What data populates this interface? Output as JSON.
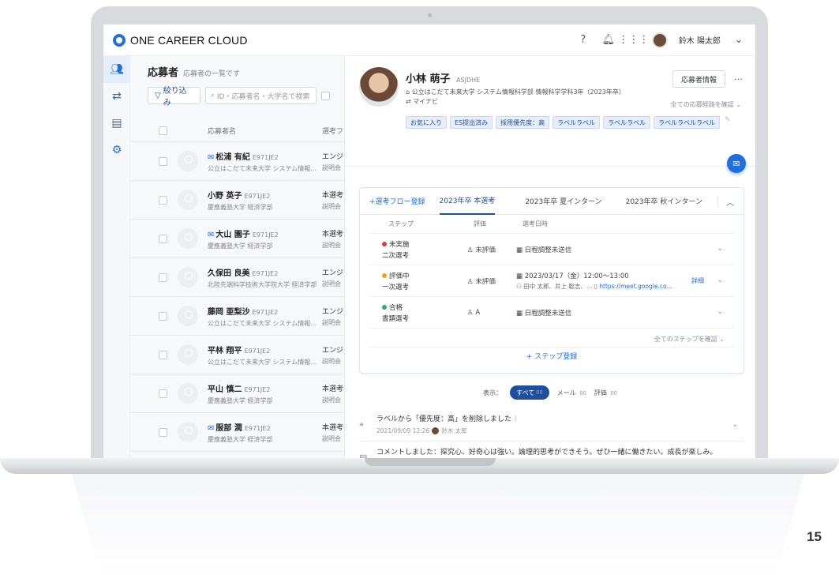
{
  "app": {
    "brand": "ONE CAREER CLOUD",
    "user_name": "鈴木 陽太郎"
  },
  "page_number": "15",
  "list": {
    "title": "応募者",
    "subtitle": "応募者の一覧です",
    "filter_label": "絞り込み",
    "search_placeholder": "ID・応募者名・大学名で検索",
    "col_name": "応募者名",
    "col_flow": "選考フ",
    "rows": [
      {
        "name": "松浦 有紀",
        "code": "E971JE2",
        "school": "公立はこだて未来大学 システム情報…",
        "flow": "エンジ",
        "event": "説明会",
        "mail": true
      },
      {
        "name": "小野 英子",
        "code": "E971JE2",
        "school": "慶應義塾大学 経済学部",
        "flow": "本選考",
        "event": "説明会",
        "mail": false
      },
      {
        "name": "大山 園子",
        "code": "E971JE2",
        "school": "慶應義塾大学 経済学部",
        "flow": "本選考",
        "event": "説明会",
        "mail": true
      },
      {
        "name": "久保田 良美",
        "code": "E971JE2",
        "school": "北陸先端科学技術大学院大学 経済学部",
        "flow": "エンジ",
        "event": "説明会",
        "mail": false
      },
      {
        "name": "藤岡 亜梨沙",
        "code": "E971JE2",
        "school": "公立はこだて未来大学 システム情報…",
        "flow": "エンジ",
        "event": "説明会",
        "mail": false
      },
      {
        "name": "平林 翔平",
        "code": "E971JE2",
        "school": "公立はこだて未来大学 システム情報…",
        "flow": "エンジ",
        "event": "説明会",
        "mail": false
      },
      {
        "name": "平山 慎二",
        "code": "E971JE2",
        "school": "慶應義塾大学 経済学部",
        "flow": "本選考",
        "event": "説明会",
        "mail": false
      },
      {
        "name": "服部 潤",
        "code": "E971JE2",
        "school": "慶應義塾大学 経済学部",
        "flow": "本選考",
        "event": "説明会",
        "mail": true
      }
    ]
  },
  "profile": {
    "name": "小林 萌子",
    "code": "ASJDHE",
    "school": "公立はこだて未来大学 システム情報科学部 情報科学学科3年（2023年卒）",
    "source": "マイナビ",
    "info_button": "応募者情報",
    "more": "…",
    "route_link": "全ての応募経路を確認",
    "labels": [
      "お気に入り",
      "ES提出済み",
      "採用優先度：高",
      "ラベルラベル",
      "ラベルラベル",
      "ラベルラベルラベル"
    ]
  },
  "flow": {
    "add_tab": "+選考フロー登録",
    "tabs": [
      "2023年卒 本選考",
      "2023年卒 夏インターン",
      "2023年卒 秋インターン"
    ],
    "col_step": "ステップ",
    "col_eval": "評価",
    "col_date": "選考日時",
    "steps": [
      {
        "status": "未実施",
        "color": "#e0393e",
        "step": "二次選考",
        "eval": "未評価",
        "date": "日程調整未送信",
        "sub": "",
        "link": ""
      },
      {
        "status": "評価中",
        "color": "#f0a020",
        "step": "一次選考",
        "eval": "未評価",
        "date": "2023/03/17（金）12:00〜13:00",
        "sub": "田中 太郎、井上 聡志、…",
        "link": "https://meet.google.co…",
        "detail": "詳細"
      },
      {
        "status": "合格",
        "color": "#2fae6b",
        "step": "書類選考",
        "eval": "A",
        "date": "日程調整未送信",
        "sub": "",
        "link": ""
      }
    ],
    "all_steps_link": "全てのステップを確認",
    "add_step": "+ ステップ登録"
  },
  "timeline_filter": {
    "label": "表示：",
    "all": "すべて",
    "all_count": "00",
    "mail": "メール",
    "mail_count": "00",
    "eval": "評価",
    "eval_count": "00"
  },
  "timeline": [
    {
      "icon": "tag-icon",
      "text": "ラベルから「優先度：高」を削除しました",
      "time": "2021/09/09 12:26",
      "user": "鈴木 太郎"
    },
    {
      "icon": "comment-icon",
      "text": "コメントしました：探究心、好奇心は強い。論理的思考ができそう。ぜひ一緒に働きたい。成長が楽しみ。",
      "time": "2021/09/09 12:26",
      "user": "鈴木 太郎"
    }
  ]
}
